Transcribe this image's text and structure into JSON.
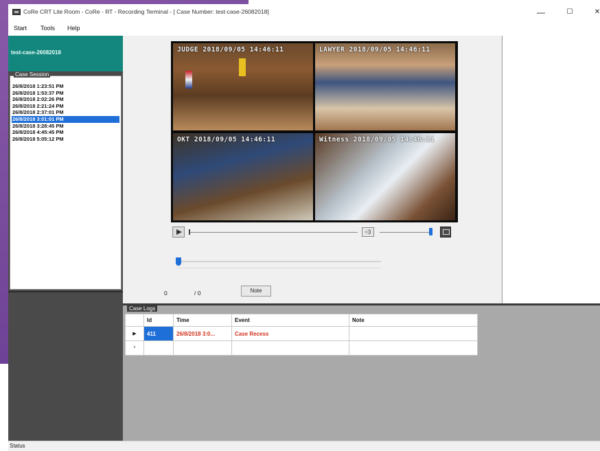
{
  "window": {
    "title": "CoRe CRT Lite Room - CoRe - RT - Recording Terminal - [ Case Number: test-case-26082018]",
    "minimize": "—",
    "maximize": "☐",
    "close": "✕"
  },
  "menu": {
    "items": [
      "Start",
      "Tools",
      "Help"
    ]
  },
  "case": {
    "number": "test-case-26082018"
  },
  "session": {
    "title": "Case Session",
    "items": [
      "26/8/2018 1:23:51 PM",
      "26/8/2018 1:53:37 PM",
      "26/8/2018 2:02:26 PM",
      "26/8/2018 2:21:24 PM",
      "26/8/2018 2:37:01 PM",
      "26/8/2018 3:01:01 PM",
      "26/8/2018 3:28:45 PM",
      "26/8/2018 4:45:45 PM",
      "26/8/2018 5:05:12 PM"
    ],
    "selected_index": 5
  },
  "video": {
    "cameras": [
      "JUDGE 2018/09/05 14:46:11",
      "LAWYER 2018/09/05 14:46:11",
      "OKT 2018/09/05 14:46:11",
      "Witness 2018/09/05 14:46:11"
    ]
  },
  "controls": {
    "play_icon": "play-icon",
    "volume_icon": "speaker-icon",
    "volume_symbol": "◁)",
    "fullscreen_icon": "fullscreen-icon",
    "seek_position": 0.0,
    "volume_level": 0.95,
    "position_slider": 0.0
  },
  "counter": {
    "current": "0",
    "total": "/ 0"
  },
  "note_button": "Note",
  "logs": {
    "title": "Case Logs",
    "columns": [
      "Id",
      "Time",
      "Event",
      "Note"
    ],
    "rows": [
      {
        "indicator": "▶",
        "id": "411",
        "time": "26/8/2018 3:0...",
        "event": "Case Recess",
        "note": ""
      },
      {
        "indicator": "*",
        "id": "",
        "time": "",
        "event": "",
        "note": ""
      }
    ]
  },
  "status": {
    "text": "Status"
  },
  "colors": {
    "accent": "#1f6fd8",
    "case_header": "#13877d",
    "event_red": "#d0321c",
    "left_panel": "#4a4a4a"
  }
}
